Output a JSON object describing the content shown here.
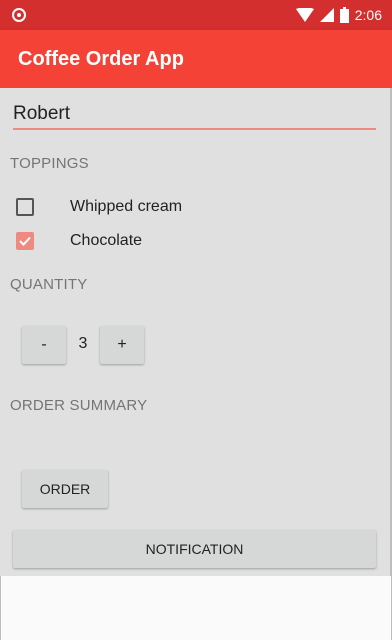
{
  "status_bar": {
    "time": "2:06",
    "icons": [
      "notification-circle-icon",
      "wifi-icon",
      "cell-signal-icon",
      "battery-icon"
    ],
    "color": "#d32f2f"
  },
  "app_bar": {
    "title": "Coffee Order App",
    "color": "#f44336"
  },
  "name_field": {
    "value": "Robert",
    "accent_color": "#ef8a80"
  },
  "toppings": {
    "header": "TOPPINGS",
    "items": [
      {
        "label": "Whipped cream",
        "checked": false
      },
      {
        "label": "Chocolate",
        "checked": true
      }
    ]
  },
  "quantity": {
    "header": "QUANTITY",
    "decrement_label": "-",
    "value": "3",
    "increment_label": "+"
  },
  "order_summary": {
    "header": "ORDER SUMMARY"
  },
  "buttons": {
    "order_label": "ORDER",
    "notification_label": "NOTIFICATION"
  },
  "colors": {
    "checkbox_checked": "#ef8a80",
    "content_bg": "#e0e0e0",
    "button_bg": "#d6d7d7"
  }
}
